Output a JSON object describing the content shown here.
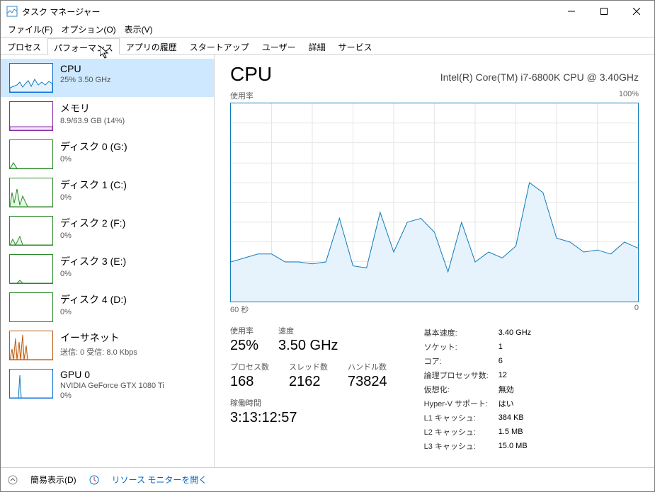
{
  "window": {
    "title": "タスク マネージャー"
  },
  "menu": {
    "file": "ファイル(F)",
    "options": "オプション(O)",
    "view": "表示(V)"
  },
  "tabs": {
    "processes": "プロセス",
    "performance": "パフォーマンス",
    "history": "アプリの履歴",
    "startup": "スタートアップ",
    "users": "ユーザー",
    "details": "詳細",
    "services": "サービス"
  },
  "sidebar": {
    "cpu": {
      "title": "CPU",
      "sub": "25%  3.50 GHz"
    },
    "mem": {
      "title": "メモリ",
      "sub": "8.9/63.9 GB (14%)"
    },
    "d0": {
      "title": "ディスク 0 (G:)",
      "sub": "0%"
    },
    "d1": {
      "title": "ディスク 1 (C:)",
      "sub": "0%"
    },
    "d2": {
      "title": "ディスク 2 (F:)",
      "sub": "0%"
    },
    "d3": {
      "title": "ディスク 3 (E:)",
      "sub": "0%"
    },
    "d4": {
      "title": "ディスク 4 (D:)",
      "sub": "0%"
    },
    "eth": {
      "title": "イーサネット",
      "sub": "送信: 0 受信: 8.0 Kbps"
    },
    "gpu": {
      "title": "GPU 0",
      "sub": "NVIDIA GeForce GTX 1080 Ti",
      "sub2": "0%"
    }
  },
  "detail": {
    "title": "CPU",
    "processor": "Intel(R) Core(TM) i7-6800K CPU @ 3.40GHz",
    "usage_label": "使用率",
    "usage_max": "100%",
    "x_start": "60 秒",
    "x_end": "0",
    "stats": {
      "usage": {
        "label": "使用率",
        "value": "25%"
      },
      "speed": {
        "label": "速度",
        "value": "3.50 GHz"
      },
      "procs": {
        "label": "プロセス数",
        "value": "168"
      },
      "threads": {
        "label": "スレッド数",
        "value": "2162"
      },
      "handles": {
        "label": "ハンドル数",
        "value": "73824"
      },
      "uptime": {
        "label": "稼働時間",
        "value": "3:13:12:57"
      }
    },
    "right": {
      "base": {
        "l": "基本速度:",
        "v": "3.40 GHz"
      },
      "sockets": {
        "l": "ソケット:",
        "v": "1"
      },
      "cores": {
        "l": "コア:",
        "v": "6"
      },
      "logical": {
        "l": "論理プロセッサ数:",
        "v": "12"
      },
      "virt": {
        "l": "仮想化:",
        "v": "無効"
      },
      "hyperv": {
        "l": "Hyper-V サポート:",
        "v": "はい"
      },
      "l1": {
        "l": "L1 キャッシュ:",
        "v": "384 KB"
      },
      "l2": {
        "l": "L2 キャッシュ:",
        "v": "1.5 MB"
      },
      "l3": {
        "l": "L3 キャッシュ:",
        "v": "15.0 MB"
      }
    }
  },
  "footer": {
    "fewer": "簡易表示(D)",
    "resmon": "リソース モニターを開く"
  },
  "chart_data": {
    "type": "line",
    "title": "CPU 使用率",
    "xlabel": "秒",
    "ylabel": "%",
    "x": [
      60,
      58,
      56,
      54,
      52,
      50,
      48,
      46,
      44,
      42,
      40,
      38,
      36,
      34,
      32,
      30,
      28,
      26,
      24,
      22,
      20,
      18,
      16,
      14,
      12,
      10,
      8,
      6,
      4,
      2,
      0
    ],
    "values": [
      20,
      22,
      24,
      24,
      20,
      20,
      19,
      20,
      42,
      18,
      17,
      45,
      25,
      40,
      42,
      35,
      15,
      40,
      20,
      25,
      22,
      28,
      60,
      55,
      32,
      30,
      25,
      26,
      24,
      30,
      27
    ],
    "ylim": [
      0,
      100
    ]
  }
}
